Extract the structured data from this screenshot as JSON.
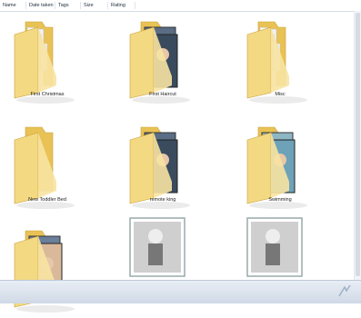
{
  "columns": [
    "Name",
    "Date taken",
    "Tags",
    "Size",
    "Rating"
  ],
  "folders": [
    {
      "name": "First Christmas",
      "kind": "docs"
    },
    {
      "name": "First Haircut",
      "kind": "photos"
    },
    {
      "name": "Misc",
      "kind": "docs"
    },
    {
      "name": "New Toddler Bed",
      "kind": "empty"
    },
    {
      "name": "remote king",
      "kind": "photos"
    },
    {
      "name": "Swimming",
      "kind": "photos-blue"
    },
    {
      "name": "",
      "kind": "photos-partial"
    },
    {
      "name": "",
      "kind": "bw-photo"
    },
    {
      "name": "",
      "kind": "bw-photo"
    }
  ],
  "colors": {
    "folder_front": "#f4d983",
    "folder_back": "#e8c255",
    "folder_edge": "#c9a13a"
  },
  "icons": {
    "folder": "folder-icon",
    "photo": "photo-thumbnail-icon"
  }
}
